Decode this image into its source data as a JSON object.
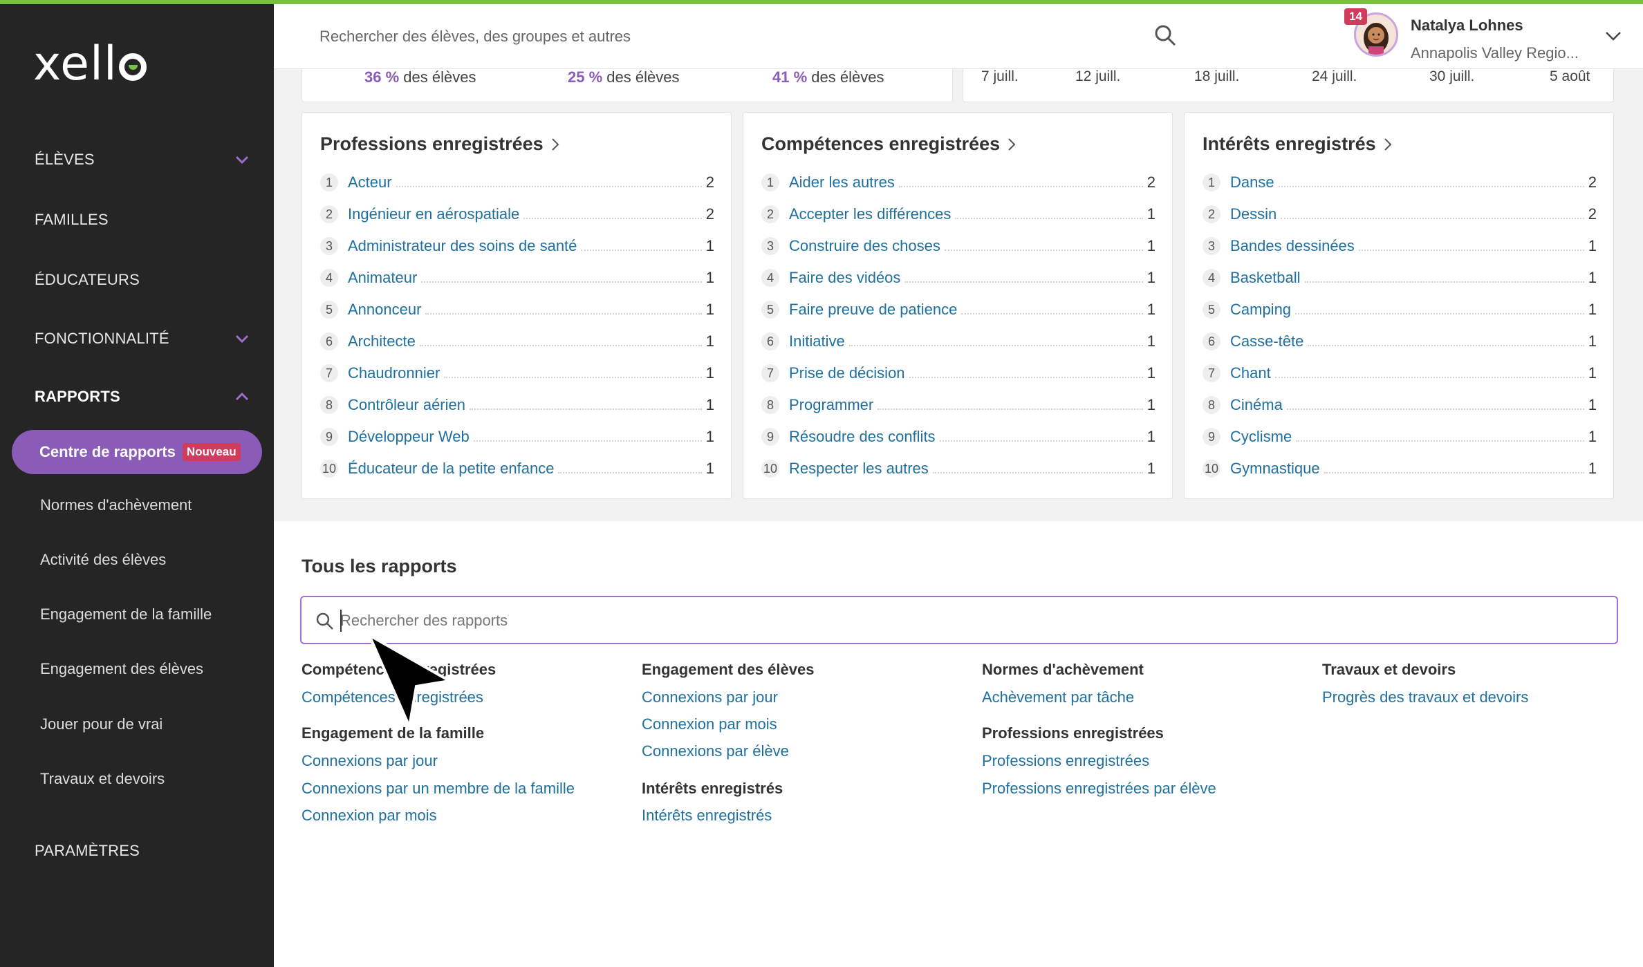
{
  "brand": {
    "logo": "xello",
    "accent": "#7ac143",
    "purple": "#8a5cb8"
  },
  "sidebar": {
    "items": [
      {
        "label": "ÉLÈVES",
        "chevron": "down"
      },
      {
        "label": "FAMILLES"
      },
      {
        "label": "ÉDUCATEURS"
      },
      {
        "label": "FONCTIONNALITÉ",
        "chevron": "down"
      },
      {
        "label": "RAPPORTS",
        "chevron": "up"
      },
      {
        "label": "PARAMÈTRES"
      }
    ],
    "active_sub": {
      "label": "Centre de rapports",
      "badge": "Nouveau"
    },
    "sub_items": [
      "Normes d'achèvement",
      "Activité des élèves",
      "Engagement de la famille",
      "Engagement des élèves",
      "Jouer pour de vrai",
      "Travaux et devoirs"
    ]
  },
  "header": {
    "search_placeholder": "Rechercher des élèves, des groupes et autres",
    "notifications": "14",
    "user_name": "Natalya Lohnes",
    "user_org": "Annapolis Valley Regio..."
  },
  "top_partial": {
    "percent_stats": [
      {
        "value": "36 %",
        "suffix": "des élèves"
      },
      {
        "value": "25 %",
        "suffix": "des élèves"
      },
      {
        "value": "41 %",
        "suffix": "des élèves"
      }
    ],
    "dates": [
      "7 juill.",
      "12 juill.",
      "18 juill.",
      "24 juill.",
      "30 juill.",
      "5 août"
    ]
  },
  "cards": [
    {
      "title": "Professions enregistrées",
      "rows": [
        {
          "rank": "1",
          "name": "Acteur",
          "count": "2"
        },
        {
          "rank": "2",
          "name": "Ingénieur en aérospatiale",
          "count": "2"
        },
        {
          "rank": "3",
          "name": "Administrateur des soins de santé",
          "count": "1"
        },
        {
          "rank": "4",
          "name": "Animateur",
          "count": "1"
        },
        {
          "rank": "5",
          "name": "Annonceur",
          "count": "1"
        },
        {
          "rank": "6",
          "name": "Architecte",
          "count": "1"
        },
        {
          "rank": "7",
          "name": "Chaudronnier",
          "count": "1"
        },
        {
          "rank": "8",
          "name": "Contrôleur aérien",
          "count": "1"
        },
        {
          "rank": "9",
          "name": "Développeur Web",
          "count": "1"
        },
        {
          "rank": "10",
          "name": "Éducateur de la petite enfance",
          "count": "1"
        }
      ]
    },
    {
      "title": "Compétences enregistrées",
      "rows": [
        {
          "rank": "1",
          "name": "Aider les autres",
          "count": "2"
        },
        {
          "rank": "2",
          "name": "Accepter les différences",
          "count": "1"
        },
        {
          "rank": "3",
          "name": "Construire des choses",
          "count": "1"
        },
        {
          "rank": "4",
          "name": "Faire des vidéos",
          "count": "1"
        },
        {
          "rank": "5",
          "name": "Faire preuve de patience",
          "count": "1"
        },
        {
          "rank": "6",
          "name": "Initiative",
          "count": "1"
        },
        {
          "rank": "7",
          "name": "Prise de décision",
          "count": "1"
        },
        {
          "rank": "8",
          "name": "Programmer",
          "count": "1"
        },
        {
          "rank": "9",
          "name": "Résoudre des conflits",
          "count": "1"
        },
        {
          "rank": "10",
          "name": "Respecter les autres",
          "count": "1"
        }
      ]
    },
    {
      "title": "Intérêts enregistrés",
      "rows": [
        {
          "rank": "1",
          "name": "Danse",
          "count": "2"
        },
        {
          "rank": "2",
          "name": "Dessin",
          "count": "2"
        },
        {
          "rank": "3",
          "name": "Bandes dessinées",
          "count": "1"
        },
        {
          "rank": "4",
          "name": "Basketball",
          "count": "1"
        },
        {
          "rank": "5",
          "name": "Camping",
          "count": "1"
        },
        {
          "rank": "6",
          "name": "Casse-tête",
          "count": "1"
        },
        {
          "rank": "7",
          "name": "Chant",
          "count": "1"
        },
        {
          "rank": "8",
          "name": "Cinéma",
          "count": "1"
        },
        {
          "rank": "9",
          "name": "Cyclisme",
          "count": "1"
        },
        {
          "rank": "10",
          "name": "Gymnastique",
          "count": "1"
        }
      ]
    }
  ],
  "all_reports": {
    "title": "Tous les rapports",
    "search_placeholder": "Rechercher des rapports",
    "groups": {
      "competences": {
        "title": "Compétences enregistrées",
        "links": [
          "Compétences enregistrées"
        ]
      },
      "famille": {
        "title": "Engagement de la famille",
        "links": [
          "Connexions par jour",
          "Connexions par un membre de la famille",
          "Connexion par mois"
        ]
      },
      "eleves": {
        "title": "Engagement des élèves",
        "links": [
          "Connexions par jour",
          "Connexion par mois",
          "Connexions par élève"
        ]
      },
      "interets": {
        "title": "Intérêts enregistrés",
        "links": [
          "Intérêts enregistrés"
        ]
      },
      "normes": {
        "title": "Normes d'achèvement",
        "links": [
          "Achèvement par tâche"
        ]
      },
      "professions": {
        "title": "Professions enregistrées",
        "links": [
          "Professions enregistrées",
          "Professions enregistrées par élève"
        ]
      },
      "travaux": {
        "title": "Travaux et devoirs",
        "links": [
          "Progrès des travaux et devoirs"
        ]
      }
    }
  }
}
